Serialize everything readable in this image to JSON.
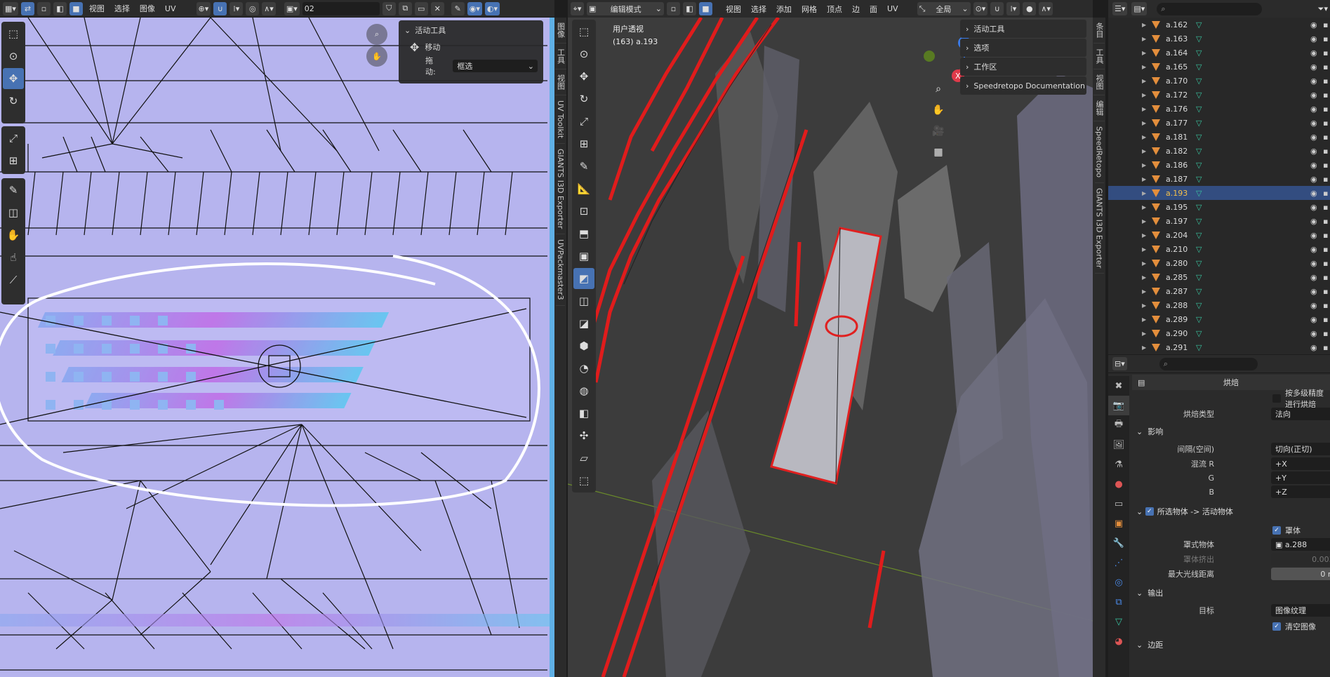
{
  "uv_editor": {
    "header": {
      "menus": [
        "视图",
        "选择",
        "图像",
        "UV"
      ],
      "image_name": "02"
    },
    "redo_panel": {
      "title": "活动工具",
      "tool": "移动",
      "drag_label": "拖动:",
      "drag_value": "框选"
    },
    "side_tabs": [
      "图像",
      "工具",
      "视图",
      "UV Toolkit",
      "GIANTS I3D Exporter",
      "UVPackmaster3"
    ]
  },
  "viewport": {
    "header": {
      "mode": "编辑模式",
      "menus": [
        "视图",
        "选择",
        "添加",
        "网格",
        "顶点",
        "边",
        "面",
        "UV"
      ],
      "orientation": "全局"
    },
    "info": {
      "view_name": "用户透视",
      "object": "(163) a.193"
    },
    "npanel": [
      "活动工具",
      "选项",
      "工作区",
      "Speedretopo Documentation"
    ],
    "side_tabs": [
      "条目",
      "工具",
      "视图",
      "编辑",
      "SpeedRetopo",
      "GIANTS I3D Exporter"
    ],
    "gizmo": {
      "x": "X",
      "y": "Y",
      "z": "Z"
    }
  },
  "outliner": {
    "rows": [
      {
        "name": "a.162",
        "selected": false
      },
      {
        "name": "a.163",
        "selected": false
      },
      {
        "name": "a.164",
        "selected": false
      },
      {
        "name": "a.165",
        "selected": false
      },
      {
        "name": "a.170",
        "selected": false
      },
      {
        "name": "a.172",
        "selected": false
      },
      {
        "name": "a.176",
        "selected": false
      },
      {
        "name": "a.177",
        "selected": false
      },
      {
        "name": "a.181",
        "selected": false
      },
      {
        "name": "a.182",
        "selected": false
      },
      {
        "name": "a.186",
        "selected": false
      },
      {
        "name": "a.187",
        "selected": false
      },
      {
        "name": "a.193",
        "selected": true
      },
      {
        "name": "a.195",
        "selected": false
      },
      {
        "name": "a.197",
        "selected": false
      },
      {
        "name": "a.204",
        "selected": false
      },
      {
        "name": "a.210",
        "selected": false
      },
      {
        "name": "a.280",
        "selected": false
      },
      {
        "name": "a.285",
        "selected": false
      },
      {
        "name": "a.287",
        "selected": false
      },
      {
        "name": "a.288",
        "selected": false
      },
      {
        "name": "a.289",
        "selected": false
      },
      {
        "name": "a.290",
        "selected": false
      },
      {
        "name": "a.291",
        "selected": false
      }
    ]
  },
  "properties": {
    "bake_title": "烘焙",
    "multires_label": "按多级精度进行烘焙",
    "bake_type_label": "烘焙类型",
    "bake_type_value": "法向",
    "influence_title": "影响",
    "space_label": "间隔(空间)",
    "space_value": "切向(正切)",
    "swizzle_r_label": "混流 R",
    "swizzle_r_value": "+X",
    "swizzle_g_label": "G",
    "swizzle_g_value": "+Y",
    "swizzle_b_label": "B",
    "swizzle_b_value": "+Z",
    "selected_to_active": "所选物体 -> 活动物体",
    "cage_label": "罩体",
    "cage_object_label": "罩式物体",
    "cage_object_value": "a.288",
    "cage_extrusion_label": "罩体挤出",
    "cage_extrusion_value": "0.003 m",
    "max_ray_label": "最大光线距离",
    "max_ray_value": "0 m",
    "output_title": "输出",
    "target_label": "目标",
    "target_value": "图像纹理",
    "clear_image_label": "清空图像",
    "margin_title": "边距"
  }
}
